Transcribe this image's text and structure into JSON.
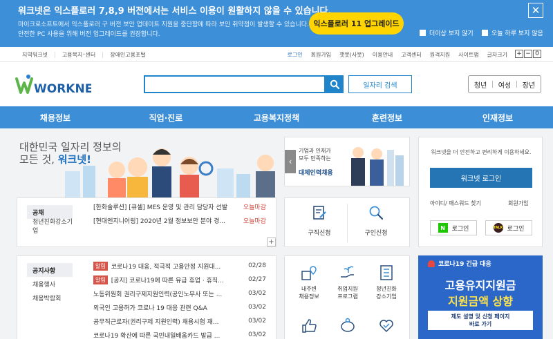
{
  "notice": {
    "title": "워크넷은 익스플로러 7,8,9 버전에서는 서비스 이용이 원활하지 않을 수 있습니다.",
    "desc1": "마이크로소프트에서 익스플로러 구 버전 보안 업데이트 지원을 중단함에 따라 보안 취약점이 발생할 수 있습니다.",
    "desc2": "안전한 PC 사용을 위해 버전 업그레이드를 권장합니다.",
    "upgrade_label": "익스플로러 11 업그레이드",
    "close_label": "✕",
    "check_no_more": "더이상 보지 않기",
    "check_today": "오늘 하루 보지 않음"
  },
  "utilbar": {
    "left": [
      "지역워크넷",
      "고용복지⁺센터",
      "장애인고용포털"
    ],
    "right": [
      "로그인",
      "회원가입",
      "챗봇(사봇)",
      "이용안내",
      "고객센터",
      "원격지원",
      "사이트맵",
      "글자크기"
    ],
    "font_buttons": [
      "+",
      "−",
      "0"
    ]
  },
  "header": {
    "logo_text": "WORKNET",
    "search_placeholder": "",
    "job_search_label": "일자리 검색",
    "targets": [
      "청년",
      "여성",
      "장년"
    ]
  },
  "gnb": [
    "채용정보",
    "직업·진로",
    "고용복지정책",
    "훈련정보",
    "인재정보"
  ],
  "hero": {
    "line1": "대한민국 일자리 정보의",
    "line2_prefix": "모든 것, ",
    "line2_brand": "워크넷!"
  },
  "banner": {
    "text1": "기업과 인재가",
    "text2": "모두 만족하는",
    "text3": "대체인력채용"
  },
  "login": {
    "intro": "워크넷을 더 안전하고 편리하게 이용하세요.",
    "login_button": "워크넷 로그인",
    "find": "아이디/ 패스워드 찾기",
    "join": "회원가입",
    "naver_icon": "N",
    "naver": "로그인",
    "kakao_icon": "TALK",
    "kakao": "로그인"
  },
  "recruit_panel": {
    "tabs": [
      "공채",
      "청년친화강소기업"
    ],
    "rows": [
      {
        "text": "[한화솔루션] [큐셀] MES 운영 및 관리 담당자 선발",
        "meta": "오늘마감"
      },
      {
        "text": "[현대엔지니어링] 2020년 2월 정보보안 분야 경...",
        "meta": "오늘마감"
      }
    ],
    "plus": "+"
  },
  "apply": {
    "job_apply": "구직신청",
    "hire_apply": "구인신청"
  },
  "notice_panel": {
    "tabs": [
      "공지사항",
      "채용행사",
      "채용박람회"
    ],
    "rows": [
      {
        "badge": "알림",
        "text": "코로나19 대응, 적극적 고용안정 지원대...",
        "date": "02/28"
      },
      {
        "badge": "알림",
        "text": "[공지] 코로나19에 따른 유급 휴업 · 휴직...",
        "date": "02/27"
      },
      {
        "badge": "",
        "text": "노동위원회 권리구제지원인력(공인노무사 또는 ...",
        "date": "03/02"
      },
      {
        "badge": "",
        "text": "외국인 고용허가 코로나 19 대응 관련 Q&A",
        "date": "03/02"
      },
      {
        "badge": "",
        "text": "공무직근로자(권리구제 지원인력) 채용시험 재...",
        "date": "03/02"
      },
      {
        "badge": "",
        "text": "코로나19 확산에 따른 국민내일배움카드 발급 ...",
        "date": "03/02"
      }
    ]
  },
  "services": [
    {
      "line1": "내주변",
      "line2": "채용정보"
    },
    {
      "line1": "취업지원",
      "line2": "프로그램"
    },
    {
      "line1": "청년친화",
      "line2": "강소기업"
    }
  ],
  "covid": {
    "header": "코로나19 긴급 대응",
    "title1": "고용유지지원금",
    "title2": "지원금액 상향",
    "sub1": "제도 설명 및 신청 페이지",
    "sub2": "바로 가기"
  },
  "colors": {
    "notice_bg": "#3d8fd8",
    "gnb_bg": "#3c8ed6",
    "accent": "#1f84c9",
    "upgrade_btn": "#ffd400",
    "covid_bg": "#2a67c9"
  }
}
